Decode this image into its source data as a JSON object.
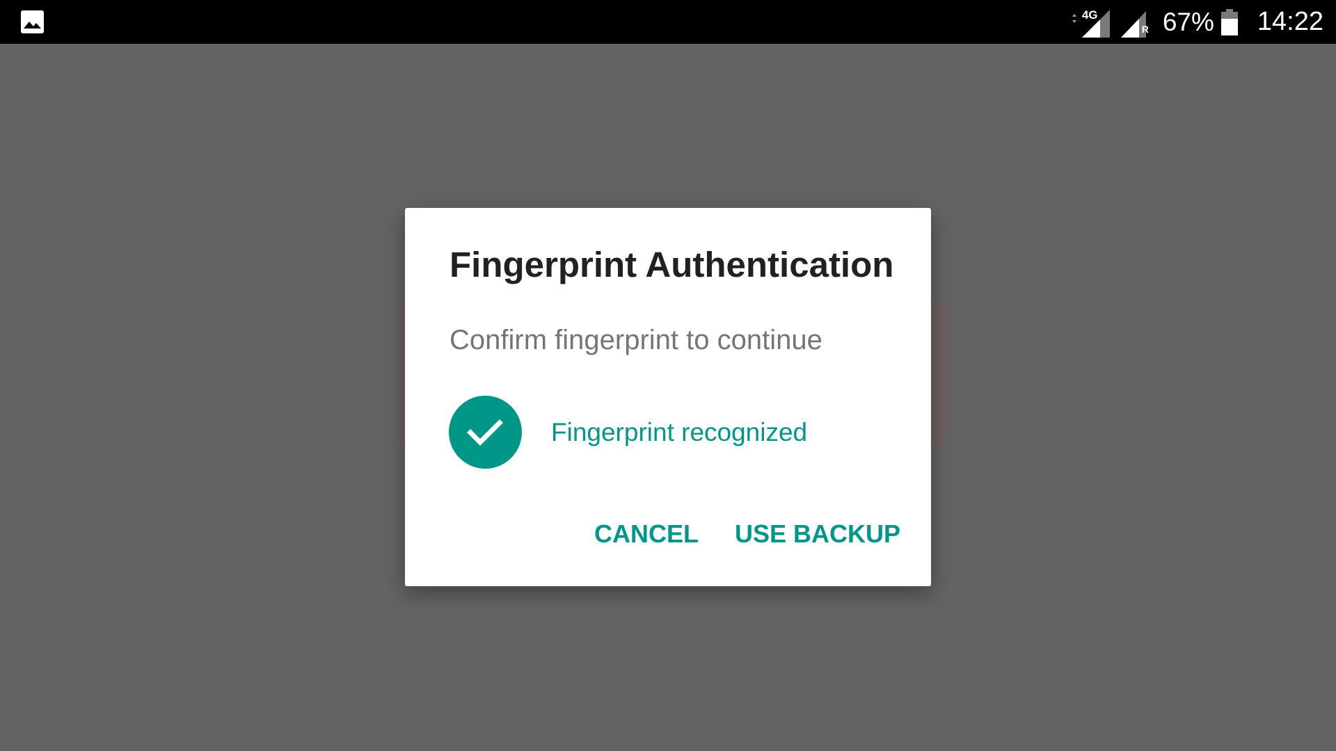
{
  "status_bar": {
    "network_type": "4G",
    "roaming_indicator": "R",
    "battery_percent": "67%",
    "clock": "14:22",
    "left_icon": "image-icon"
  },
  "dialog": {
    "title": "Fingerprint Authentication",
    "description": "Confirm fingerprint to continue",
    "status_text": "Fingerprint recognized",
    "status_icon": "check-icon",
    "cancel_label": "CANCEL",
    "backup_label": "USE BACKUP"
  },
  "colors": {
    "accent": "#009688",
    "scrim": "#636363",
    "status_bar": "#000000",
    "dialog_bg": "#ffffff",
    "title_text": "#212121",
    "secondary_text": "#757575"
  }
}
